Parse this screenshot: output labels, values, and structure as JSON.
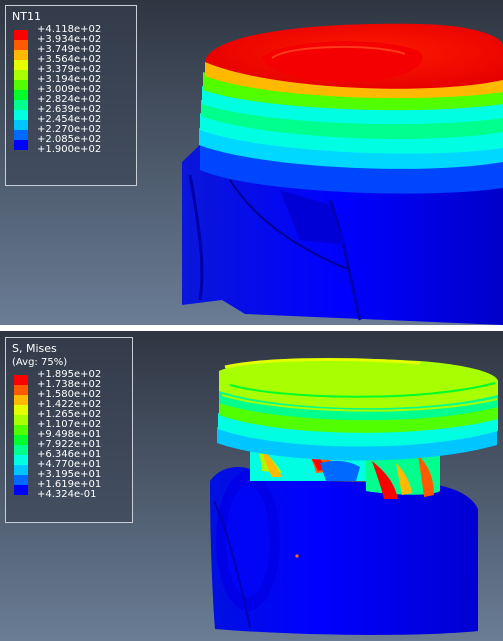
{
  "viewports": [
    {
      "id": "thermal",
      "legend": {
        "title": "NT11",
        "subtitle": "",
        "colors": [
          "#ff0000",
          "#ff5a00",
          "#ffb900",
          "#e3ff00",
          "#a7ff00",
          "#52ff00",
          "#00ff2a",
          "#00ff8d",
          "#00ffe2",
          "#00c6ff",
          "#0069ff",
          "#0000ff"
        ],
        "values": [
          "+4.118e+02",
          "+3.934e+02",
          "+3.749e+02",
          "+3.564e+02",
          "+3.379e+02",
          "+3.194e+02",
          "+3.009e+02",
          "+2.824e+02",
          "+2.639e+02",
          "+2.454e+02",
          "+2.270e+02",
          "+2.085e+02",
          "+1.900e+02"
        ]
      }
    },
    {
      "id": "stress",
      "legend": {
        "title": "S, Mises",
        "subtitle": "(Avg: 75%)",
        "colors": [
          "#ff0000",
          "#ff5a00",
          "#ffb900",
          "#e3ff00",
          "#a7ff00",
          "#52ff00",
          "#00ff2a",
          "#00ff8d",
          "#00ffe2",
          "#00c6ff",
          "#0069ff",
          "#0000ff"
        ],
        "values": [
          "+1.895e+02",
          "+1.738e+02",
          "+1.580e+02",
          "+1.422e+02",
          "+1.265e+02",
          "+1.107e+02",
          "+9.498e+01",
          "+7.922e+01",
          "+6.346e+01",
          "+4.770e+01",
          "+3.195e+01",
          "+1.619e+01",
          "+4.324e-01"
        ]
      }
    }
  ],
  "colors": {
    "background_top": "#2f3642",
    "background_bottom": "#6a7d95",
    "divider": "#ffffff"
  }
}
